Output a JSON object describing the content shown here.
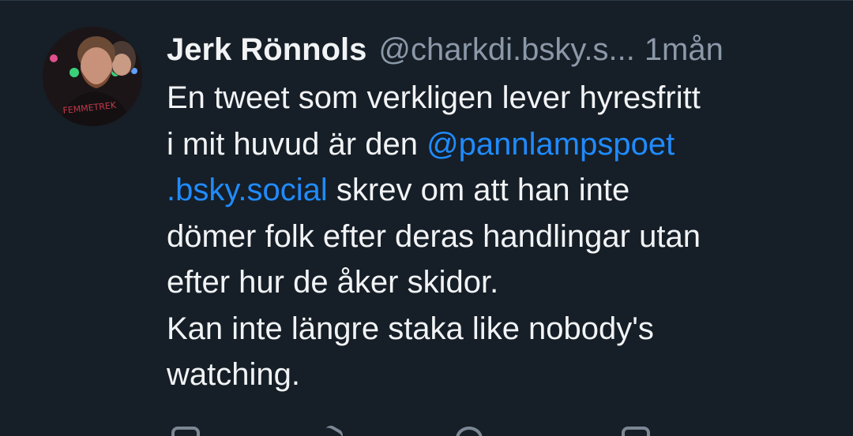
{
  "post": {
    "author": {
      "display_name": "Jerk Rönnols",
      "handle": "@charkdi.bsky.s...",
      "timestamp": "1mån"
    },
    "body": {
      "line1": "En tweet som verkligen lever hyresfritt",
      "line2_text": "i mit huvud är den ",
      "mention_part1": "@pannlampspoet",
      "mention_part2": ".bsky.social",
      "line3_text": " skrev om att han inte",
      "line4": "dömer folk efter deras handlingar utan",
      "line5": "efter hur de åker skidor.",
      "line6": "Kan inte längre staka like nobody's",
      "line7": "watching."
    },
    "avatar_shirt_text": "FEMMETREK",
    "colors": {
      "background": "#161e27",
      "text": "#f1f3f5",
      "muted": "#8b98a8",
      "link": "#208bfe"
    },
    "actions": [
      "reply-icon",
      "repost-icon",
      "like-icon",
      "more-icon"
    ]
  }
}
